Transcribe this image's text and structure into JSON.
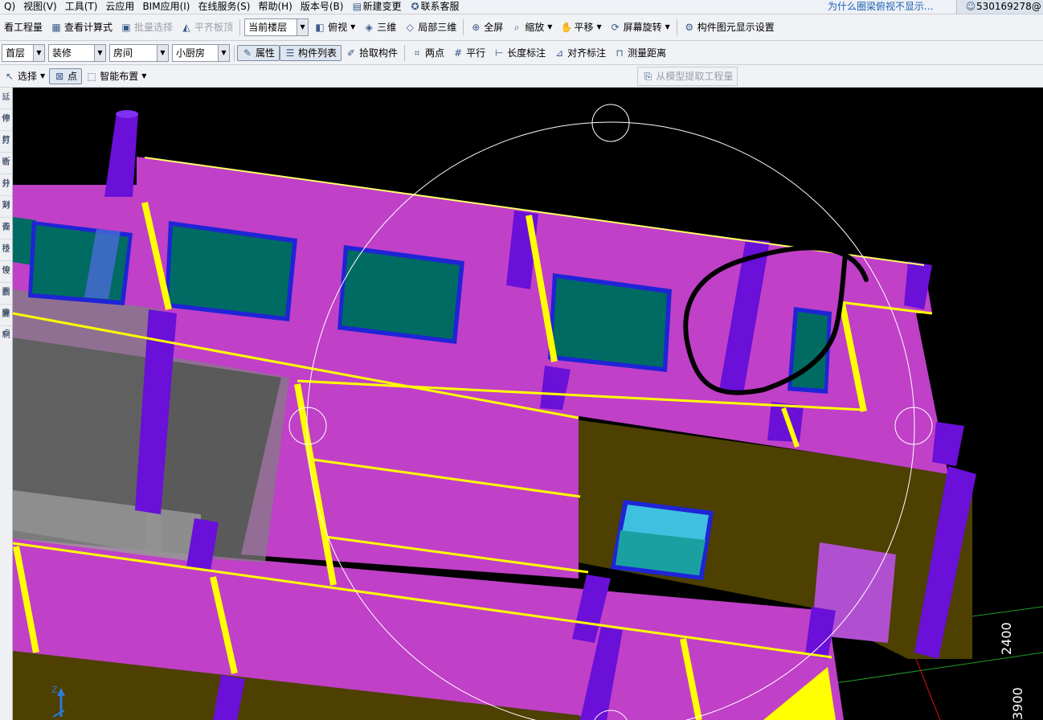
{
  "menubar": {
    "items": [
      "Q)",
      "视图(V)",
      "工具(T)",
      "云应用",
      "BIM应用(I)",
      "在线服务(S)",
      "帮助(H)",
      "版本号(B)",
      "新建变更",
      "联系客服"
    ],
    "question_link": "为什么圈梁俯视不显示...",
    "user": "530169278@"
  },
  "toolbar1": {
    "view_quantity": "看工程量",
    "view_formula": "查看计算式",
    "batch_select": "批量选择",
    "flush_slab": "平齐板顶",
    "floor_scope": "当前楼层",
    "top_view": "俯视",
    "three_d": "三维",
    "local_3d": "局部三维",
    "full_screen": "全屏",
    "zoom": "缩放",
    "pan": "平移",
    "screen_rotate": "屏幕旋转",
    "display_settings": "构件图元显示设置"
  },
  "toolbar2": {
    "floor": "首层",
    "category": "装修",
    "type": "房间",
    "component": "小厨房",
    "properties": "属性",
    "component_list": "构件列表",
    "pick_component": "拾取构件",
    "two_points": "两点",
    "parallel": "平行",
    "length_dim": "长度标注",
    "align_dim": "对齐标注",
    "measure_distance": "测量距离"
  },
  "toolbar3": {
    "select": "选择",
    "point": "点",
    "smart_layout": "智能布置",
    "extract_quantity": "从模型提取工程量"
  },
  "left_rail": [
    "延伸",
    "修剪",
    "打断",
    "合并",
    "分割",
    "对齐",
    "偏移",
    "拉伸",
    "设置夹点",
    "删除",
    "复制"
  ],
  "viewport": {
    "dim_labels": [
      "2400",
      "3900"
    ],
    "axis_label": "Z",
    "colors": {
      "background": "#000000",
      "wall": "#c040c8",
      "wall_edge": "#ff66ff",
      "column": "#6a10d8",
      "beam": "#ffff00",
      "window": "#006b63",
      "window_frame": "#1f24d6",
      "floor": "#4d4000",
      "glass_window": "#40c0e0",
      "grey_panel": "#808080",
      "orbit_circle": "#ffffff",
      "annotation": "#000000"
    }
  }
}
